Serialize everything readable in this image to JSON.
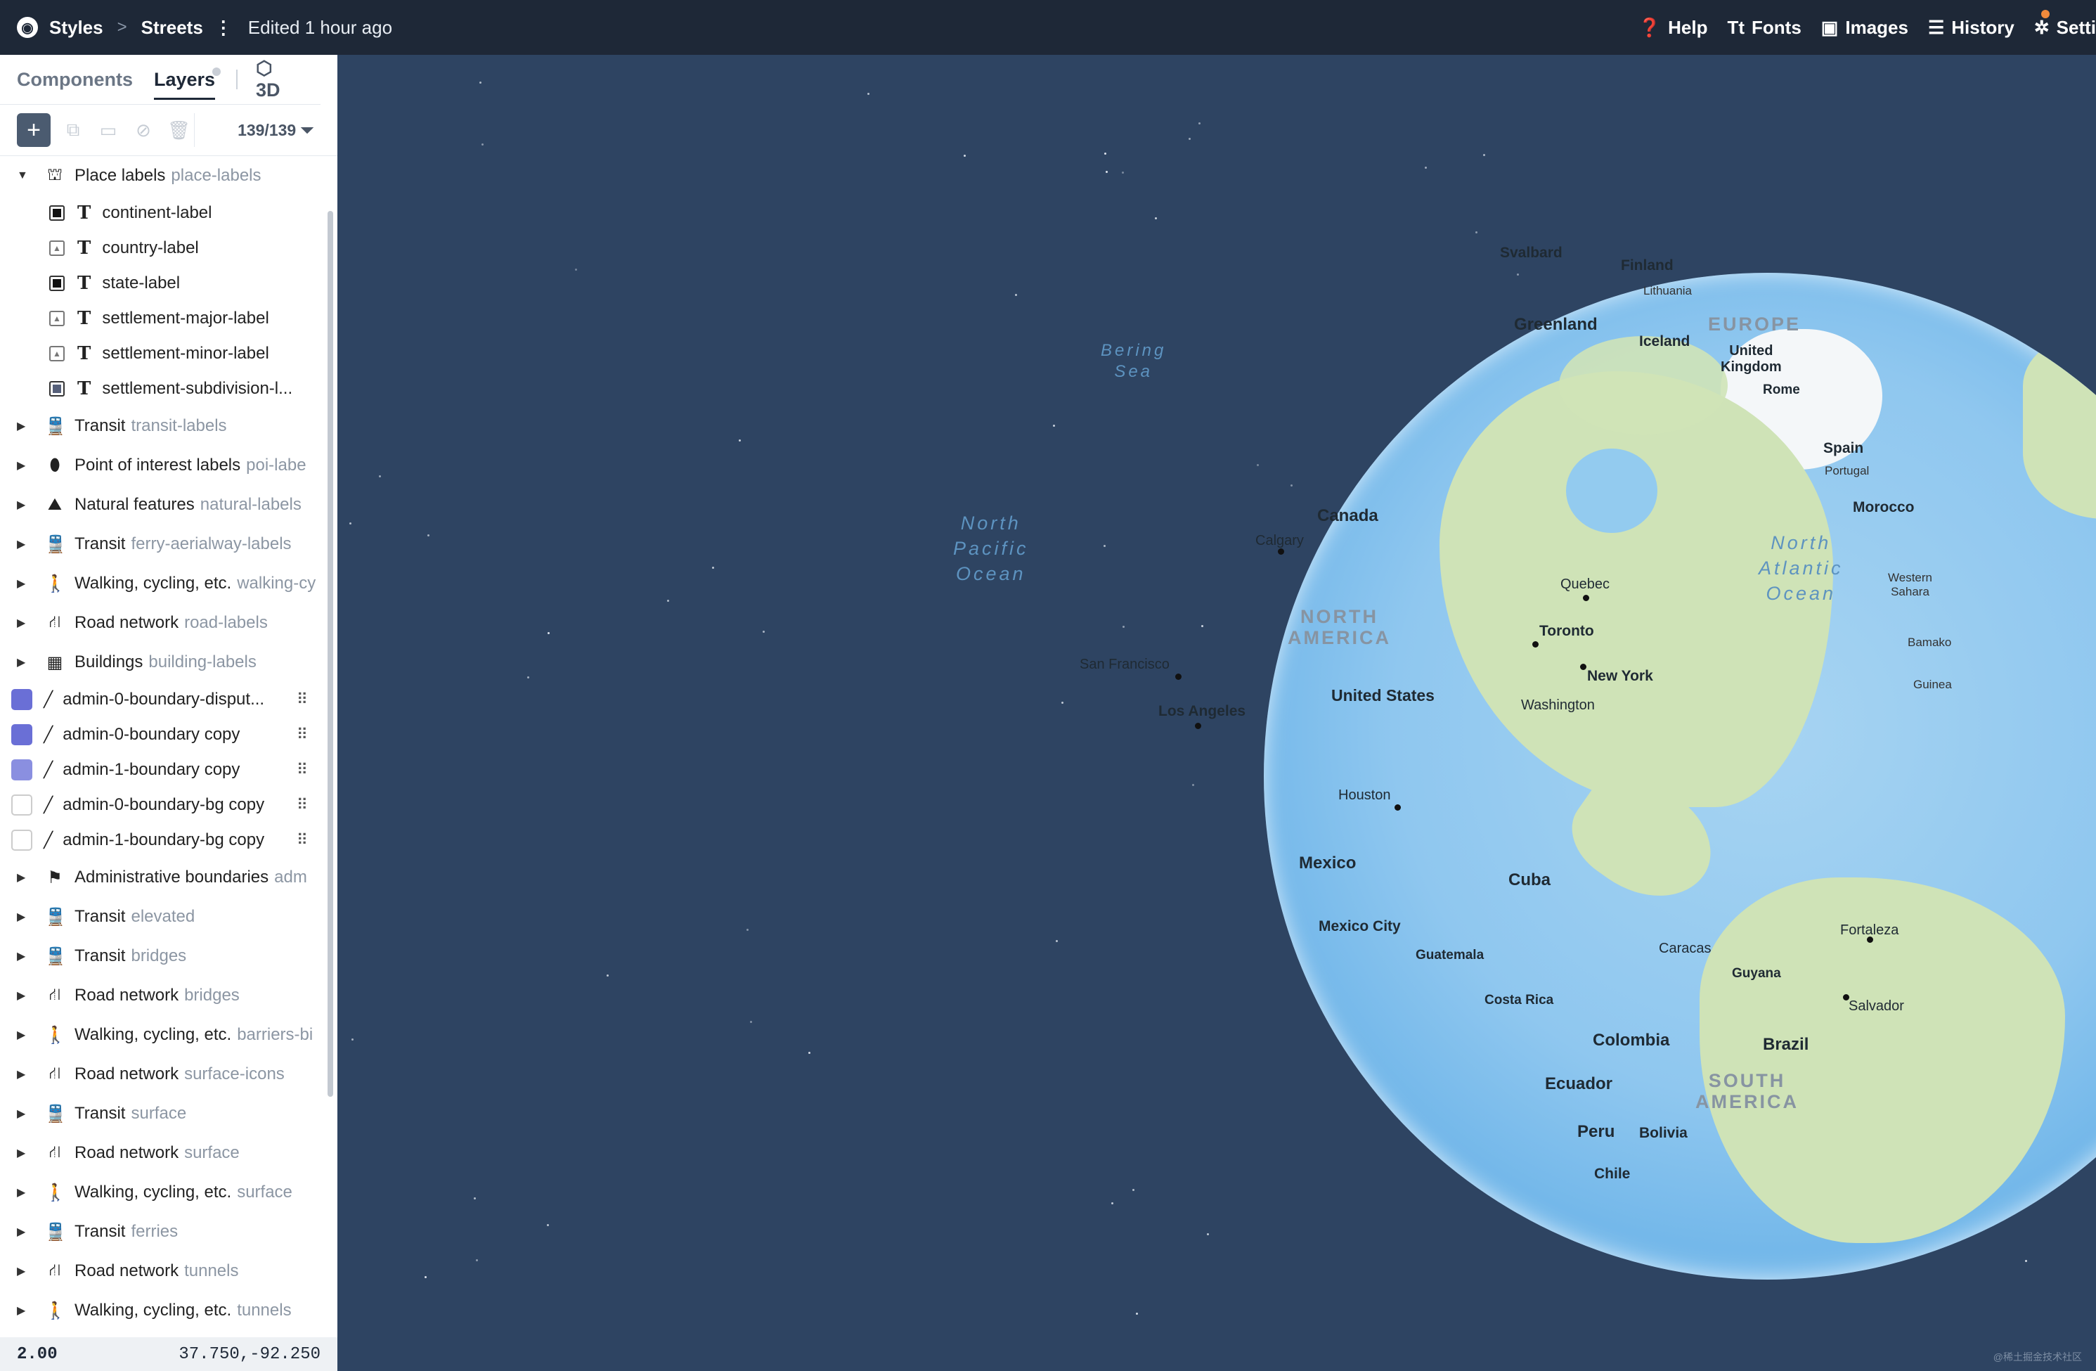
{
  "topbar": {
    "styles": "Styles",
    "separator": ">",
    "style_name": "Streets",
    "edited": "Edited 1 hour ago",
    "help": "Help",
    "fonts": "Fonts",
    "images": "Images",
    "history": "History",
    "settings": "Setti"
  },
  "sidebar": {
    "tabs": {
      "components": "Components",
      "layers": "Layers",
      "threed": "3D"
    },
    "layer_count": "139/139",
    "groups": [
      {
        "name": "Place labels",
        "id": "place-labels",
        "icon": "place-icon"
      }
    ],
    "children": [
      {
        "label": "continent-label"
      },
      {
        "label": "country-label"
      },
      {
        "label": "state-label"
      },
      {
        "label": "settlement-major-label"
      },
      {
        "label": "settlement-minor-label"
      },
      {
        "label": "settlement-subdivision-l..."
      }
    ],
    "groups2": [
      {
        "name": "Transit",
        "id": "transit-labels"
      },
      {
        "name": "Point of interest labels",
        "id": "poi-labe"
      },
      {
        "name": "Natural features",
        "id": "natural-labels"
      },
      {
        "name": "Transit",
        "id": "ferry-aerialway-labels"
      },
      {
        "name": "Walking, cycling, etc.",
        "id": "walking-cy"
      },
      {
        "name": "Road network",
        "id": "road-labels"
      },
      {
        "name": "Buildings",
        "id": "building-labels"
      }
    ],
    "plain_layers": [
      {
        "label": "admin-0-boundary-disput...",
        "color": "#6a6fd6"
      },
      {
        "label": "admin-0-boundary copy",
        "color": "#6a6fd6"
      },
      {
        "label": "admin-1-boundary copy",
        "color": "#8a8fe0"
      },
      {
        "label": "admin-0-boundary-bg copy",
        "color": "#ffffff"
      },
      {
        "label": "admin-1-boundary-bg copy",
        "color": "#ffffff"
      }
    ],
    "groups3": [
      {
        "name": "Administrative boundaries",
        "id": "adm"
      },
      {
        "name": "Transit",
        "id": "elevated"
      },
      {
        "name": "Transit",
        "id": "bridges"
      },
      {
        "name": "Road network",
        "id": "bridges"
      },
      {
        "name": "Walking, cycling, etc.",
        "id": "barriers-bi"
      },
      {
        "name": "Road network",
        "id": "surface-icons"
      },
      {
        "name": "Transit",
        "id": "surface"
      },
      {
        "name": "Road network",
        "id": "surface"
      },
      {
        "name": "Walking, cycling, etc.",
        "id": "surface"
      },
      {
        "name": "Transit",
        "id": "ferries"
      },
      {
        "name": "Road network",
        "id": "tunnels"
      },
      {
        "name": "Walking, cycling, etc.",
        "id": "tunnels"
      }
    ],
    "zoom": "2.00",
    "coords": "37.750,-92.250"
  },
  "map": {
    "labels": {
      "svalbard": "Svalbard",
      "finland": "Finland",
      "lithuania": "Lithuania",
      "greenland": "Greenland",
      "iceland": "Iceland",
      "europe": "EUROPE",
      "uk": "United\nKingdom",
      "rome": "Rome",
      "bering": "Bering\nSea",
      "canada": "Canada",
      "calgary": "Calgary",
      "spain": "Spain",
      "portugal": "Portugal",
      "morocco": "Morocco",
      "npo": "North\nPacific\nOcean",
      "nao": "North\nAtlantic\nOcean",
      "quebec": "Quebec",
      "westernsahara": "Western\nSahara",
      "northamerica": "NORTH\nAMERICA",
      "toronto": "Toronto",
      "bamako": "Bamako",
      "sanfrancisco": "San Francisco",
      "newyork": "New York",
      "guinea": "Guinea",
      "unitedstates": "United States",
      "washington": "Washington",
      "losangeles": "Los Angeles",
      "houston": "Houston",
      "mexico": "Mexico",
      "cuba": "Cuba",
      "mexicocity": "Mexico City",
      "fortaleza": "Fortaleza",
      "guatemala": "Guatemala",
      "caracas": "Caracas",
      "guyana": "Guyana",
      "costarica": "Costa Rica",
      "salvador": "Salvador",
      "colombia": "Colombia",
      "brazil": "Brazil",
      "ecuador": "Ecuador",
      "southamerica": "SOUTH\nAMERICA",
      "peru": "Peru",
      "bolivia": "Bolivia",
      "chile": "Chile"
    },
    "watermark": "@稀土掘金技术社区"
  },
  "colors": {
    "topbar": "#1e2837",
    "space": "#2e4462",
    "ocean": "#8fc7ef",
    "land": "#cfe3b7",
    "accent_dot": "#f08a3c"
  }
}
